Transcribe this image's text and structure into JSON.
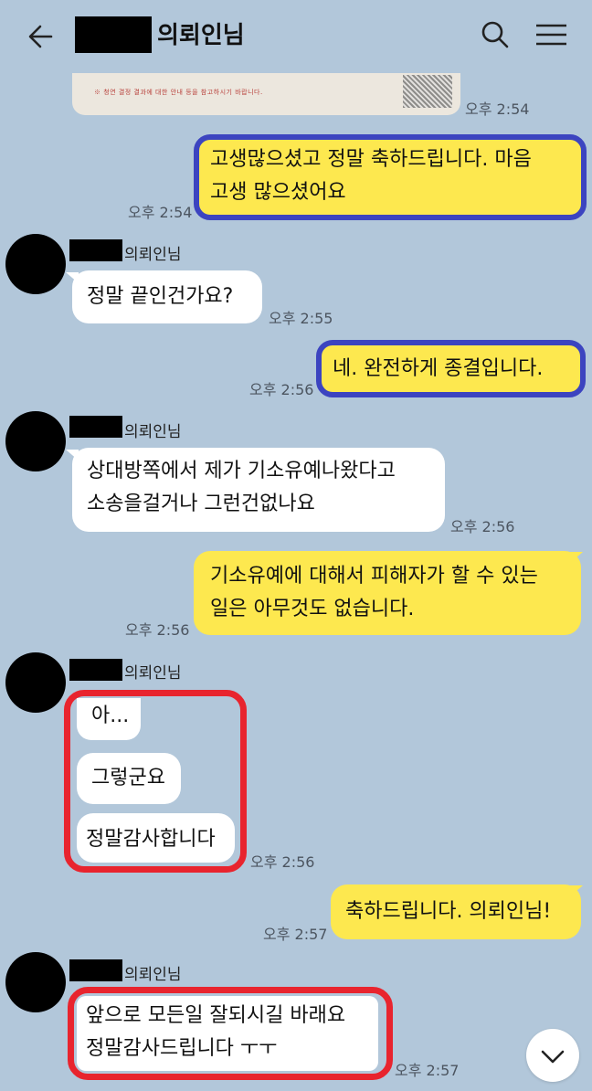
{
  "header": {
    "title": "의뢰인님",
    "back_icon": "back-arrow-icon",
    "search_icon": "search-icon",
    "menu_icon": "hamburger-menu-icon"
  },
  "image_preview": {
    "caption": "※ 청연 결정 결과에 대한 안내 등을 참고하시기 바랍니다."
  },
  "messages": [
    {
      "sender": "me",
      "text_lines": [
        "고생많으셨고 정말 축하드립니다. 마음",
        "고생 많으셨어요"
      ],
      "time": "오후 2:54"
    },
    {
      "sender": "client",
      "name": "의뢰인님",
      "text_lines": [
        "정말 끝인건가요?"
      ],
      "time": "오후 2:55"
    },
    {
      "sender": "me",
      "text_lines": [
        "네. 완전하게 종결입니다."
      ],
      "time": "오후 2:56"
    },
    {
      "sender": "client",
      "name": "의뢰인님",
      "text_lines": [
        "상대방쪽에서 제가 기소유예나왔다고",
        "소송을걸거나 그런건없나요"
      ],
      "time": "오후 2:56"
    },
    {
      "sender": "me",
      "text_lines": [
        "기소유예에 대해서 피해자가 할 수 있는",
        "일은 아무것도 없습니다."
      ],
      "time": "오후 2:56"
    },
    {
      "sender": "client",
      "name": "의뢰인님",
      "bubbles": [
        "아...",
        "그렇군요",
        "정말감사합니다"
      ],
      "time": "오후 2:56"
    },
    {
      "sender": "me",
      "text_lines": [
        "축하드립니다. 의뢰인님!"
      ],
      "time": "오후 2:57"
    },
    {
      "sender": "client",
      "name": "의뢰인님",
      "text_lines": [
        "앞으로 모든일 잘되시길 바래요",
        "정말감사드립니다 ㅜㅜ"
      ],
      "time": "오후 2:57"
    }
  ],
  "image_time": "오후 2:54",
  "scroll_down_icon": "chevron-down-icon",
  "colors": {
    "background": "#b2c7da",
    "my_bubble": "#fde84f",
    "their_bubble": "#ffffff",
    "highlight_blue": "#3c44c0",
    "highlight_red": "#e8242e"
  }
}
